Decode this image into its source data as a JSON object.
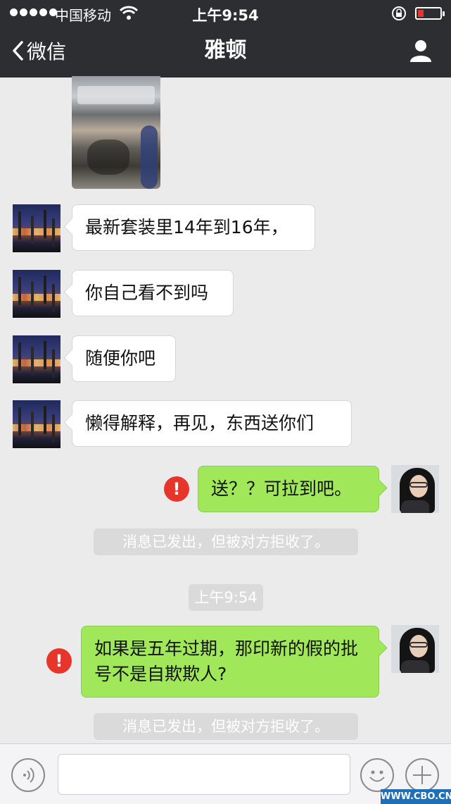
{
  "status_bar": {
    "carrier": "中国移动",
    "time": "上午9:54",
    "battery_color": "#e8352b"
  },
  "nav": {
    "back_label": "微信",
    "title": "雅顿",
    "back_icon": "chevron-left-icon",
    "profile_icon": "person-icon"
  },
  "messages": [
    {
      "side": "left",
      "type": "image",
      "text": ""
    },
    {
      "side": "left",
      "type": "text",
      "text": "最新套装里14年到16年，"
    },
    {
      "side": "left",
      "type": "text",
      "text": "你自己看不到吗"
    },
    {
      "side": "left",
      "type": "text",
      "text": "随便你吧"
    },
    {
      "side": "left",
      "type": "text",
      "text": "懒得解释，再见，东西送你们"
    },
    {
      "side": "right",
      "type": "text",
      "text": "送？？可拉到吧。",
      "failed": true
    },
    {
      "side": "right",
      "type": "text",
      "text": "如果是五年过期，那印新的假的批号不是自欺欺人?",
      "failed": true
    }
  ],
  "system_notices": {
    "rejected_1": "消息已发出，但被对方拒收了。",
    "timestamp": "上午9:54",
    "rejected_2": "消息已发出，但被对方拒收了。"
  },
  "error_mark": "!",
  "input_bar": {
    "placeholder": "",
    "voice_icon": "voice-icon",
    "emoji_icon": "emoji-icon",
    "plus_icon": "plus-icon"
  },
  "watermark": "WWW.CBO.CN",
  "colors": {
    "nav_bg": "#2d2e32",
    "chat_bg": "#ebebeb",
    "sent_bubble": "#a0e75a",
    "received_bubble": "#ffffff",
    "error": "#e8352b"
  }
}
